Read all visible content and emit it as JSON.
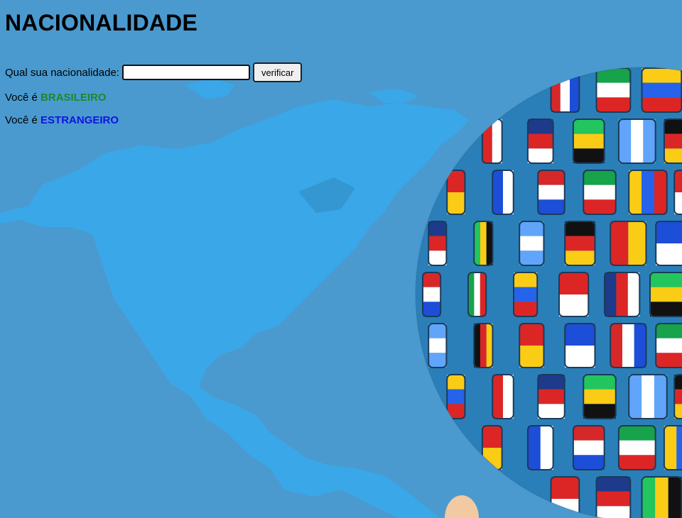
{
  "page": {
    "title": "NACIONALIDADE"
  },
  "form": {
    "question_label": "Qual sua nacionalidade:",
    "input_value": "",
    "button_label": "verificar"
  },
  "results": [
    {
      "prefix": "Você é",
      "value": "BRASILEIRO",
      "color": "#1a8a2a"
    },
    {
      "prefix": "Você é",
      "value": "ESTRANGEIRO",
      "color": "#1212e0"
    }
  ],
  "background": {
    "ocean_color": "#4a9ad0",
    "land_color": "#3aa7e8",
    "image": "world-map-with-flag-globe"
  }
}
